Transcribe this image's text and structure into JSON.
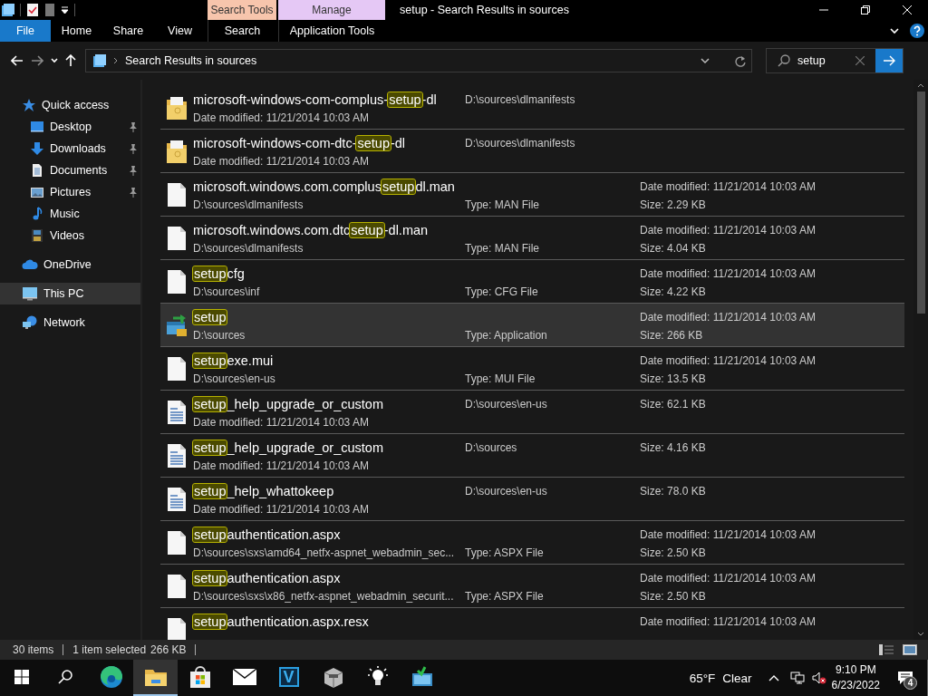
{
  "window": {
    "title": "setup - Search Results in sources"
  },
  "ribbon": {
    "tabs": [
      {
        "label": "File",
        "kind": "file"
      },
      {
        "label": "Home",
        "kind": "plain"
      },
      {
        "label": "Share",
        "kind": "plain"
      },
      {
        "label": "View",
        "kind": "plain"
      }
    ],
    "contextual": [
      {
        "header": "Search Tools",
        "tab": "Search",
        "color": "#f7c5ac"
      },
      {
        "header": "Manage",
        "tab": "Application Tools",
        "color": "#e5c8f5"
      }
    ]
  },
  "address": {
    "path": "Search Results in sources"
  },
  "search": {
    "value": "setup"
  },
  "sidebar": {
    "items": [
      {
        "label": "Quick access",
        "kind": "star",
        "selected": false,
        "children": [
          {
            "label": "Desktop",
            "kind": "desktop",
            "pinned": true,
            "selected": false
          },
          {
            "label": "Downloads",
            "kind": "download",
            "pinned": true,
            "selected": false
          },
          {
            "label": "Documents",
            "kind": "documents",
            "pinned": true,
            "selected": false
          },
          {
            "label": "Pictures",
            "kind": "pictures",
            "pinned": true,
            "selected": false
          },
          {
            "label": "Music",
            "kind": "music",
            "pinned": false,
            "selected": false
          },
          {
            "label": "Videos",
            "kind": "videos",
            "pinned": false,
            "selected": false
          }
        ]
      },
      {
        "label": "OneDrive",
        "kind": "cloud",
        "selected": false
      },
      {
        "label": "This PC",
        "kind": "pc",
        "selected": true
      },
      {
        "label": "Network",
        "kind": "network",
        "selected": false
      }
    ]
  },
  "results": [
    {
      "kind": "folder",
      "selected": false,
      "name": [
        {
          "text": "microsoft-windows-com-complus-",
          "match": false
        },
        {
          "text": "setup",
          "match": true
        },
        {
          "text": "-dl",
          "match": false
        }
      ],
      "line2": "Date modified: 11/21/2014 10:03 AM",
      "mid_top": "D:\\sources\\dlmanifests"
    },
    {
      "kind": "folder",
      "selected": false,
      "name": [
        {
          "text": "microsoft-windows-com-dtc-",
          "match": false
        },
        {
          "text": "setup",
          "match": true
        },
        {
          "text": "-dl",
          "match": false
        }
      ],
      "line2": "Date modified: 11/21/2014 10:03 AM",
      "mid_top": "D:\\sources\\dlmanifests"
    },
    {
      "kind": "file",
      "selected": false,
      "name": [
        {
          "text": "microsoft.windows.com.complus",
          "match": false
        },
        {
          "text": "setup",
          "match": true
        },
        {
          "text": "dl.man",
          "match": false
        }
      ],
      "line2": "D:\\sources\\dlmanifests",
      "mid_bottom": "Type: MAN File",
      "right_top": "Date modified: 11/21/2014 10:03 AM",
      "right_bottom": "Size: 2.29 KB"
    },
    {
      "kind": "file",
      "selected": false,
      "name": [
        {
          "text": "microsoft.windows.com.dtc",
          "match": false
        },
        {
          "text": "setup",
          "match": true
        },
        {
          "text": "-dl.man",
          "match": false
        }
      ],
      "line2": "D:\\sources\\dlmanifests",
      "mid_bottom": "Type: MAN File",
      "right_top": "Date modified: 11/21/2014 10:03 AM",
      "right_bottom": "Size: 4.04 KB"
    },
    {
      "kind": "file",
      "selected": false,
      "name": [
        {
          "text": "setup",
          "match": true
        },
        {
          "text": "cfg",
          "match": false
        }
      ],
      "line2": "D:\\sources\\inf",
      "mid_bottom": "Type: CFG File",
      "right_top": "Date modified: 11/21/2014 10:03 AM",
      "right_bottom": "Size: 4.22 KB"
    },
    {
      "kind": "app",
      "selected": true,
      "name": [
        {
          "text": "setup",
          "match": true
        }
      ],
      "line2": "D:\\sources",
      "mid_bottom": "Type: Application",
      "right_top": "Date modified: 11/21/2014 10:03 AM",
      "right_bottom": "Size: 266 KB"
    },
    {
      "kind": "file",
      "selected": false,
      "name": [
        {
          "text": "setup",
          "match": true
        },
        {
          "text": "exe.mui",
          "match": false
        }
      ],
      "line2": "D:\\sources\\en-us",
      "mid_bottom": "Type: MUI File",
      "right_top": "Date modified: 11/21/2014 10:03 AM",
      "right_bottom": "Size: 13.5 KB"
    },
    {
      "kind": "text",
      "selected": false,
      "name": [
        {
          "text": "setup",
          "match": true
        },
        {
          "text": "_help_upgrade_or_custom",
          "match": false
        }
      ],
      "line2": "Date modified: 11/21/2014 10:03 AM",
      "mid_top": "D:\\sources\\en-us",
      "right_top": "Size: 62.1 KB"
    },
    {
      "kind": "text",
      "selected": false,
      "name": [
        {
          "text": "setup",
          "match": true
        },
        {
          "text": "_help_upgrade_or_custom",
          "match": false
        }
      ],
      "line2": "Date modified: 11/21/2014 10:03 AM",
      "mid_top": "D:\\sources",
      "right_top": "Size: 4.16 KB"
    },
    {
      "kind": "text",
      "selected": false,
      "name": [
        {
          "text": "setup",
          "match": true
        },
        {
          "text": "_help_whattokeep",
          "match": false
        }
      ],
      "line2": "Date modified: 11/21/2014 10:03 AM",
      "mid_top": "D:\\sources\\en-us",
      "right_top": "Size: 78.0 KB"
    },
    {
      "kind": "file",
      "selected": false,
      "name": [
        {
          "text": "setup",
          "match": true
        },
        {
          "text": "authentication.aspx",
          "match": false
        }
      ],
      "line2": "D:\\sources\\sxs\\amd64_netfx-aspnet_webadmin_sec...",
      "mid_bottom": "Type: ASPX File",
      "right_top": "Date modified: 11/21/2014 10:03 AM",
      "right_bottom": "Size: 2.50 KB"
    },
    {
      "kind": "file",
      "selected": false,
      "name": [
        {
          "text": "setup",
          "match": true
        },
        {
          "text": "authentication.aspx",
          "match": false
        }
      ],
      "line2": "D:\\sources\\sxs\\x86_netfx-aspnet_webadmin_securit...",
      "mid_bottom": "Type: ASPX File",
      "right_top": "Date modified: 11/21/2014 10:03 AM",
      "right_bottom": "Size: 2.50 KB"
    },
    {
      "kind": "file",
      "selected": false,
      "name": [
        {
          "text": "setup",
          "match": true
        },
        {
          "text": "authentication.aspx.resx",
          "match": false
        }
      ],
      "right_top": "Date modified: 11/21/2014 10:03 AM"
    }
  ],
  "status_bar": {
    "count": "30 items",
    "selection": "1 item selected",
    "size": "266 KB"
  },
  "taskbar": {
    "apps": [
      {
        "kind": "edge",
        "active": false
      },
      {
        "kind": "explorer",
        "active": true
      },
      {
        "kind": "store",
        "active": false
      },
      {
        "kind": "mail",
        "active": false
      },
      {
        "kind": "letter",
        "label": "V",
        "active": false
      },
      {
        "kind": "package",
        "active": false
      },
      {
        "kind": "bulb",
        "active": false
      },
      {
        "kind": "setup",
        "active": false
      }
    ],
    "weather": {
      "temperature": "65°F",
      "condition": "Clear"
    },
    "clock": {
      "time": "9:10 PM",
      "date": "6/23/2022"
    },
    "notifications": "4"
  }
}
